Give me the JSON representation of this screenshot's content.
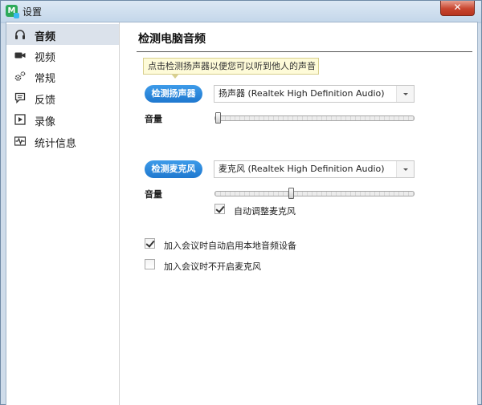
{
  "window": {
    "title": "设置",
    "logo_text": "M",
    "close_label": "✕"
  },
  "sidebar": {
    "items": [
      {
        "label": "音频",
        "icon": "headphones-icon",
        "active": true
      },
      {
        "label": "视频",
        "icon": "video-camera-icon",
        "active": false
      },
      {
        "label": "常规",
        "icon": "gear-icon",
        "active": false
      },
      {
        "label": "反馈",
        "icon": "chat-bubble-icon",
        "active": false
      },
      {
        "label": "录像",
        "icon": "play-record-icon",
        "active": false
      },
      {
        "label": "统计信息",
        "icon": "waveform-stats-icon",
        "active": false
      }
    ]
  },
  "main": {
    "title": "检测电脑音频",
    "tooltip": "点击检测扬声器以便您可以听到他人的声音",
    "speaker": {
      "button_label": "检测扬声器",
      "device": "扬声器 (Realtek High Definition Audio)",
      "volume_label": "音量",
      "volume": 0.0
    },
    "microphone": {
      "button_label": "检测麦克风",
      "device": "麦克风 (Realtek High Definition Audio)",
      "volume_label": "音量",
      "volume": 0.38,
      "auto_adjust_label": "自动调整麦克风",
      "auto_adjust": true
    },
    "options": [
      {
        "label": "加入会议时自动启用本地音频设备",
        "checked": true
      },
      {
        "label": "加入会议时不开启麦克风",
        "checked": false
      }
    ]
  },
  "colors": {
    "accent": "#2b88dc",
    "active_nav": "#dbe2eb",
    "tooltip_bg": "#fefbd8"
  }
}
